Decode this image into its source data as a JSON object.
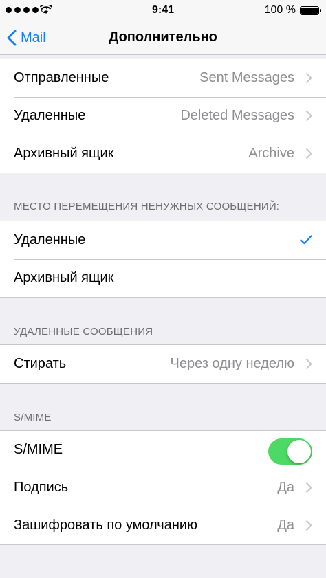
{
  "status_bar": {
    "time": "9:41",
    "battery": "100 %"
  },
  "nav": {
    "back_label": "Mail",
    "title": "Дополнительно"
  },
  "mailbox_behaviors": [
    {
      "label": "Отправленные",
      "value": "Sent Messages"
    },
    {
      "label": "Удаленные",
      "value": "Deleted Messages"
    },
    {
      "label": "Архивный ящик",
      "value": "Archive"
    }
  ],
  "move_discarded": {
    "header": "МЕСТО ПЕРЕМЕЩЕНИЯ НЕНУЖНЫХ СООБЩЕНИЙ:",
    "options": [
      {
        "label": "Удаленные",
        "selected": true
      },
      {
        "label": "Архивный ящик",
        "selected": false
      }
    ]
  },
  "deleted_messages": {
    "header": "УДАЛЕННЫЕ СООБЩЕНИЯ",
    "remove": {
      "label": "Стирать",
      "value": "Через одну неделю"
    }
  },
  "smime": {
    "header": "S/MIME",
    "toggle": {
      "label": "S/MIME",
      "on": true
    },
    "sign": {
      "label": "Подпись",
      "value": "Да"
    },
    "encrypt": {
      "label": "Зашифровать по умолчанию",
      "value": "Да"
    }
  },
  "colors": {
    "accent": "#157efb",
    "toggle_on": "#4cd964",
    "secondary_text": "#8e8e93",
    "background": "#efeff4"
  }
}
